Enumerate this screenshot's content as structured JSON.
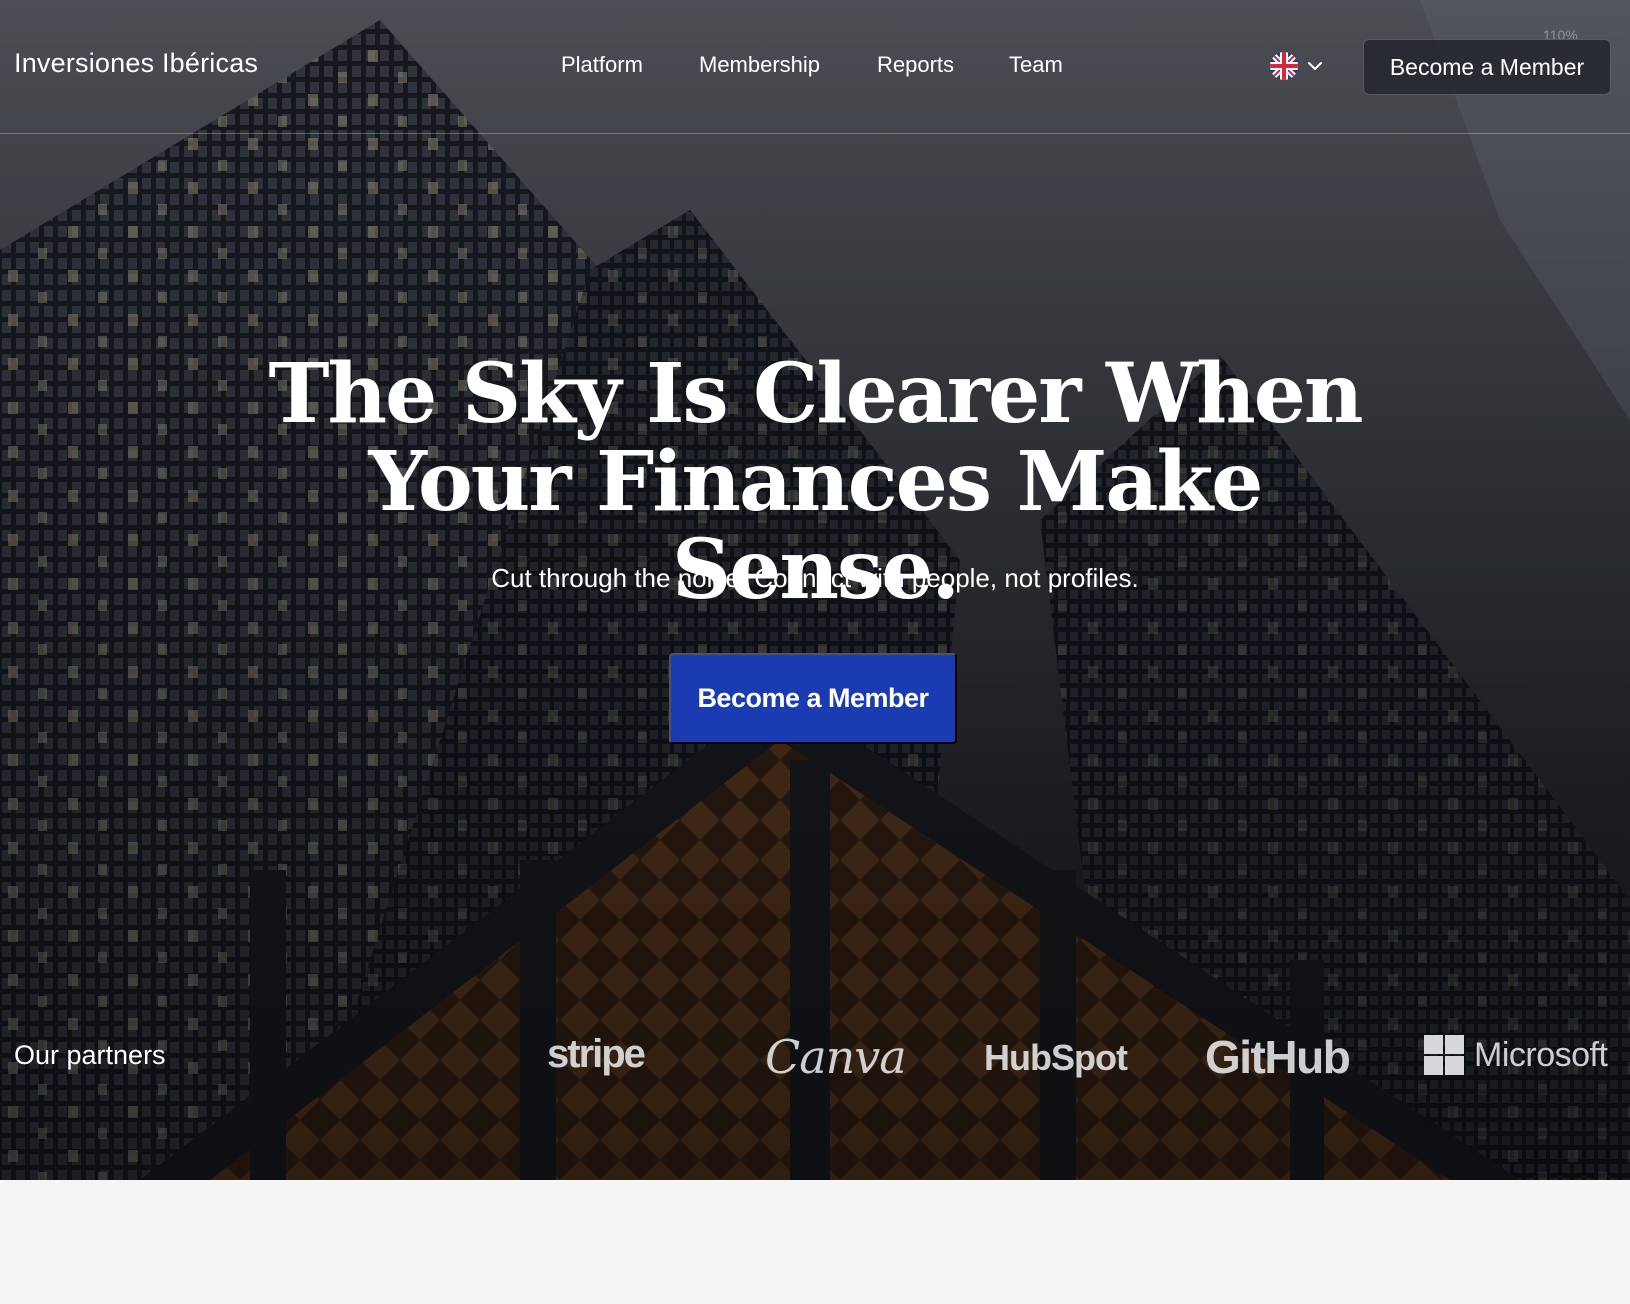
{
  "nav": {
    "brand": "Inversiones Ibéricas",
    "links": [
      "Platform",
      "Membership",
      "Reports",
      "Team"
    ],
    "language": {
      "icon": "uk-flag-icon",
      "chevron": "chevron-down-icon"
    },
    "zoom": "110%",
    "cta_label": "Become a Member"
  },
  "hero": {
    "headline_line1": "The Sky Is Clearer When",
    "headline_line2": "Your Finances Make Sense.",
    "subheadline": "Cut through the noise. Connect with people, not profiles.",
    "cta_label": "Become a Member",
    "background": "skyscrapers-photo"
  },
  "partners": {
    "label": "Our partners",
    "logos": [
      "stripe",
      "Canva",
      "HubSpot",
      "GitHub",
      "Microsoft"
    ]
  },
  "colors": {
    "primary_button": "#1b3bb3",
    "nav_button": "#262930",
    "text": "#ffffff",
    "page_background": "#f4f5f4"
  }
}
